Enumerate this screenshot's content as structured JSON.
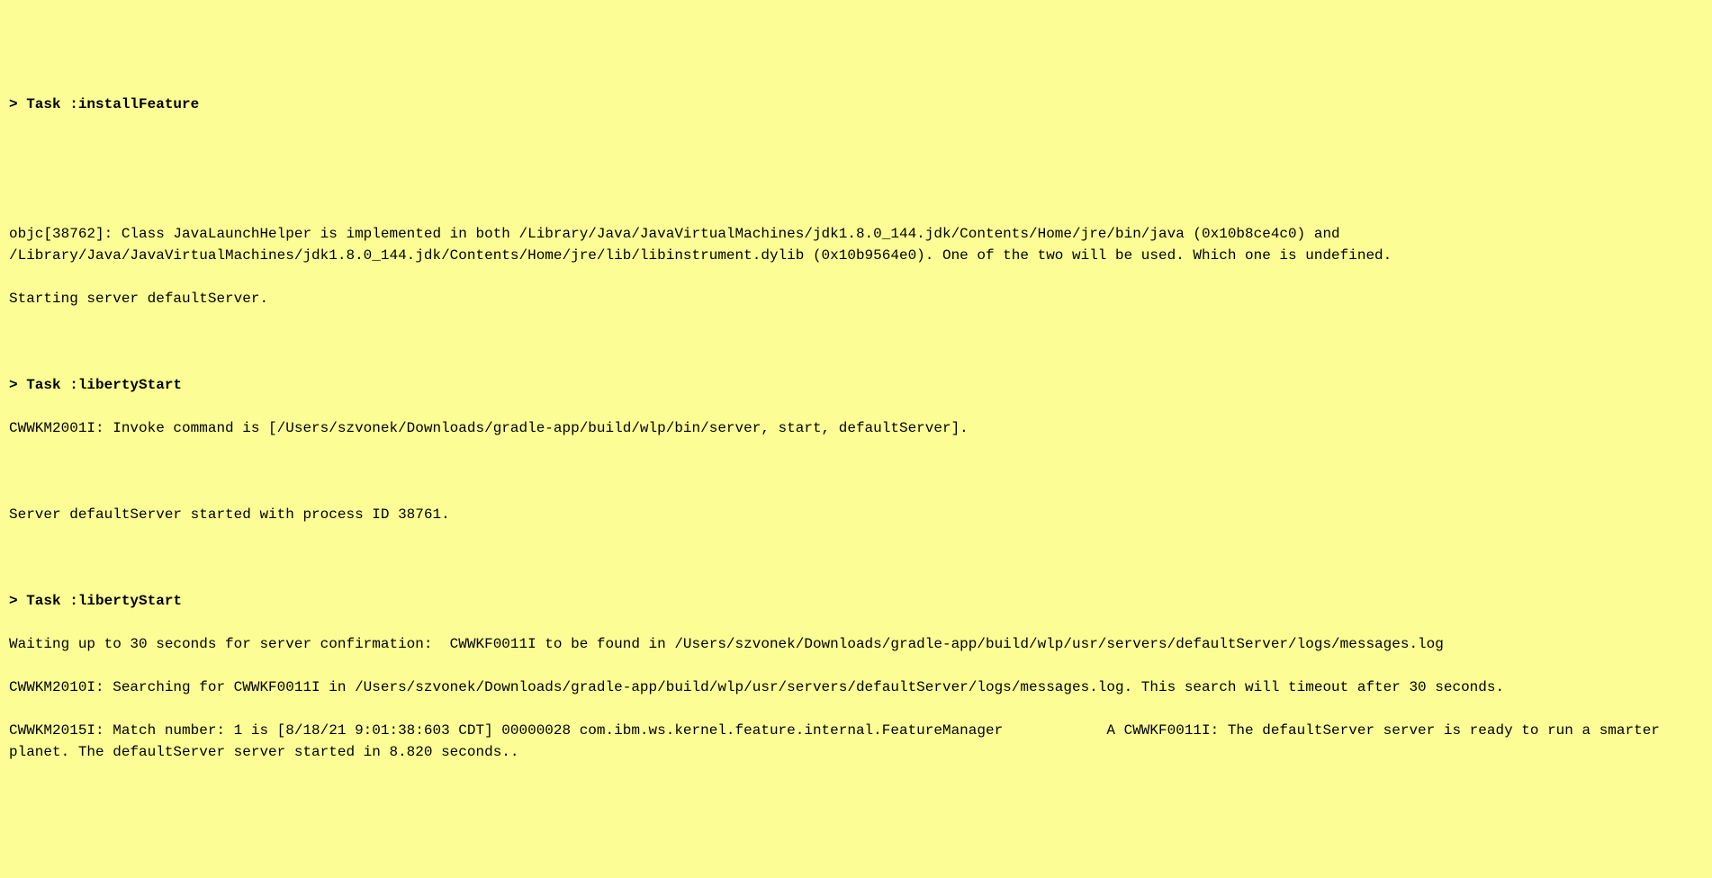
{
  "console": {
    "taskInstallFeature": "> Task :installFeature",
    "objcWarning": "objc[38762]: Class JavaLaunchHelper is implemented in both /Library/Java/JavaVirtualMachines/jdk1.8.0_144.jdk/Contents/Home/jre/bin/java (0x10b8ce4c0) and /Library/Java/JavaVirtualMachines/jdk1.8.0_144.jdk/Contents/Home/jre/lib/libinstrument.dylib (0x10b9564e0). One of the two will be used. Which one is undefined.",
    "startingServer": "Starting server defaultServer.",
    "taskLibertyStart1": "> Task :libertyStart",
    "invokeCommand": "CWWKM2001I: Invoke command is [/Users/szvonek/Downloads/gradle-app/build/wlp/bin/server, start, defaultServer].",
    "serverStarted": "Server defaultServer started with process ID 38761.",
    "taskLibertyStart2": "> Task :libertyStart",
    "waitingConfirmation": "Waiting up to 30 seconds for server confirmation:  CWWKF0011I to be found in /Users/szvonek/Downloads/gradle-app/build/wlp/usr/servers/defaultServer/logs/messages.log",
    "searching": "CWWKM2010I: Searching for CWWKF0011I in /Users/szvonek/Downloads/gradle-app/build/wlp/usr/servers/defaultServer/logs/messages.log. This search will timeout after 30 seconds.",
    "matchResult": "CWWKM2015I: Match number: 1 is [8/18/21 9:01:38:603 CDT] 00000028 com.ibm.ws.kernel.feature.internal.FeatureManager            A CWWKF0011I: The defaultServer server is ready to run a smarter planet. The defaultServer server started in 8.820 seconds.."
  }
}
